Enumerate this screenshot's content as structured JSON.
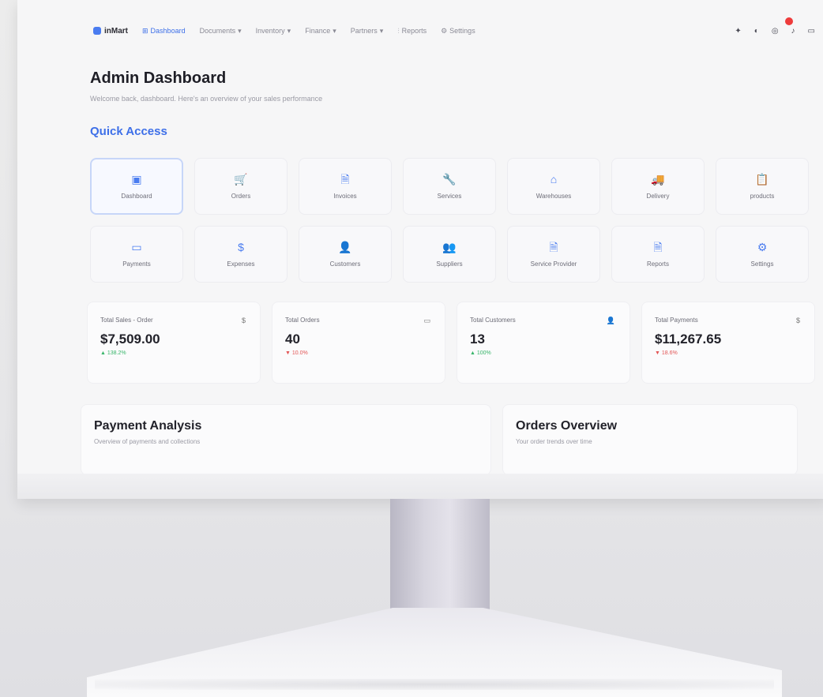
{
  "nav": {
    "brand": "inMart",
    "items": [
      {
        "label": "Dashboard",
        "icon": "grid-icon",
        "active": true
      },
      {
        "label": "Documents",
        "icon": "chevron-down-icon"
      },
      {
        "label": "Inventory",
        "icon": "chevron-down-icon"
      },
      {
        "label": "Finance",
        "icon": "chevron-down-icon"
      },
      {
        "label": "Partners",
        "icon": "chevron-down-icon"
      },
      {
        "label": "Reports",
        "icon": "chart-icon"
      },
      {
        "label": "Settings",
        "icon": "gear-icon"
      }
    ],
    "right_icons": [
      "search-icon",
      "moon-icon",
      "globe-icon",
      "bell-icon",
      "user-icon"
    ]
  },
  "header": {
    "title": "Admin Dashboard",
    "subtitle": "Welcome back, dashboard. Here's an overview of your sales performance"
  },
  "quick_access": {
    "title": "Quick Access",
    "items": [
      {
        "label": "Dashboard",
        "glyph": "▣",
        "active": true
      },
      {
        "label": "Orders",
        "glyph": "🛒"
      },
      {
        "label": "Invoices",
        "glyph": "🗎"
      },
      {
        "label": "Services",
        "glyph": "🔧"
      },
      {
        "label": "Warehouses",
        "glyph": "⌂"
      },
      {
        "label": "Delivery",
        "glyph": "🚚"
      },
      {
        "label": "products",
        "glyph": "📋"
      },
      {
        "label": "Payments",
        "glyph": "▭"
      },
      {
        "label": "Expenses",
        "glyph": "$"
      },
      {
        "label": "Customers",
        "glyph": "👤"
      },
      {
        "label": "Suppliers",
        "glyph": "👥"
      },
      {
        "label": "Service Provider",
        "glyph": "🗎"
      },
      {
        "label": "Reports",
        "glyph": "🗎"
      },
      {
        "label": "Settings",
        "glyph": "⚙"
      }
    ]
  },
  "stats": [
    {
      "label": "Total Sales - Order",
      "value": "$7,509.00",
      "change": "▲ 138.2%",
      "trend": "up",
      "icon": "$"
    },
    {
      "label": "Total Orders",
      "value": "40",
      "change": "▼ 10.0%",
      "trend": "down",
      "icon": "▭"
    },
    {
      "label": "Total Customers",
      "value": "13",
      "change": "▲ 100%",
      "trend": "up",
      "icon": "👤"
    },
    {
      "label": "Total Payments",
      "value": "$11,267.65",
      "change": "▼ 18.6%",
      "trend": "down",
      "icon": "$"
    }
  ],
  "panels": {
    "payment": {
      "title": "Payment Analysis",
      "subtitle": "Overview of payments and collections"
    },
    "orders": {
      "title": "Orders Overview",
      "subtitle": "Your order trends over time"
    }
  },
  "colors": {
    "accent": "#3d6fe8",
    "up": "#38b56a",
    "down": "#e25555",
    "notification": "#ee3b3b"
  }
}
